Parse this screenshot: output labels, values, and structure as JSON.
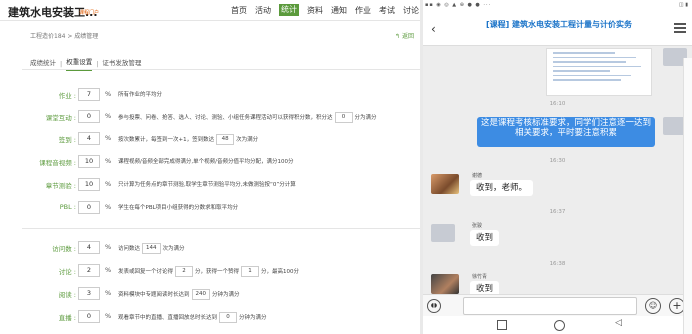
{
  "left": {
    "course_title": "建筑水电安装工...",
    "portal_link": "课程门户",
    "nav": [
      "首页",
      "活动",
      "统计",
      "资料",
      "通知",
      "作业",
      "考试",
      "讨论"
    ],
    "nav_active_index": 2,
    "breadcrumb": "工程造价184 > 成绩管理",
    "back_link": "返回",
    "tabs": [
      "成绩统计",
      "权重设置",
      "证书发放管理"
    ],
    "active_tab": 1,
    "unit": "%",
    "rows": [
      {
        "label": "作业 :",
        "value": "7",
        "desc_parts": [
          "所有作业的平均分"
        ]
      },
      {
        "label": "课堂互动 :",
        "value": "0",
        "desc_parts": [
          "参与投票、问卷、抢答、选人、讨论、测验、小组任务课程活动可以获得积分数，积分达",
          "0",
          "分为满分"
        ]
      },
      {
        "label": "签到 :",
        "value": "4",
        "desc_parts": [
          "按次数累计，每签到一次+1，签到数达",
          "48",
          "次为满分"
        ]
      },
      {
        "label": "课程音视频 :",
        "value": "10",
        "desc_parts": [
          "课程视频/音频全部完成得满分,单个视频/音频分值平均分配，满分100分"
        ]
      },
      {
        "label": "章节测验 :",
        "value": "10",
        "desc_parts": [
          "只计算为任务点的章节测验,取学生章节测验平均分,未做测验按“0”分计算"
        ]
      },
      {
        "label": "PBL :",
        "value": "0",
        "desc_parts": [
          "学生在每个PBL项目小组获得的分数求和取平均分"
        ]
      },
      {
        "label": "访问数 :",
        "value": "4",
        "desc_parts": [
          "访问数达",
          "144",
          "次为满分"
        ]
      },
      {
        "label": "讨论 :",
        "value": "2",
        "desc_parts": [
          "发表或回复一个讨论得",
          "2",
          "分，获得一个赞得",
          "1",
          "分，最高100分"
        ]
      },
      {
        "label": "阅读 :",
        "value": "3",
        "desc_parts": [
          "资料模块中专题阅读时长达到",
          "240",
          "分钟为满分"
        ]
      },
      {
        "label": "直播 :",
        "value": "0",
        "desc_parts": [
          "观看章节中的直播、直播回放总时长达到",
          "0",
          "分钟为满分"
        ]
      }
    ]
  },
  "phone": {
    "chat_title": "[课程] 建筑水电安装工程计量与计价实务",
    "messages": [
      {
        "type": "time",
        "text": "16:10"
      },
      {
        "type": "self",
        "text": "这是课程考核标准要求，同学们注意逐一达到相关要求，平时要注意积累"
      },
      {
        "type": "time",
        "text": "16:30"
      },
      {
        "type": "other",
        "sender": "谢德",
        "text": "收到，老师。"
      },
      {
        "type": "time",
        "text": "16:37"
      },
      {
        "type": "other",
        "sender": "张骏",
        "text": "收到"
      },
      {
        "type": "time",
        "text": "16:38"
      },
      {
        "type": "other",
        "sender": "徐竹青",
        "text": "收到"
      }
    ]
  }
}
